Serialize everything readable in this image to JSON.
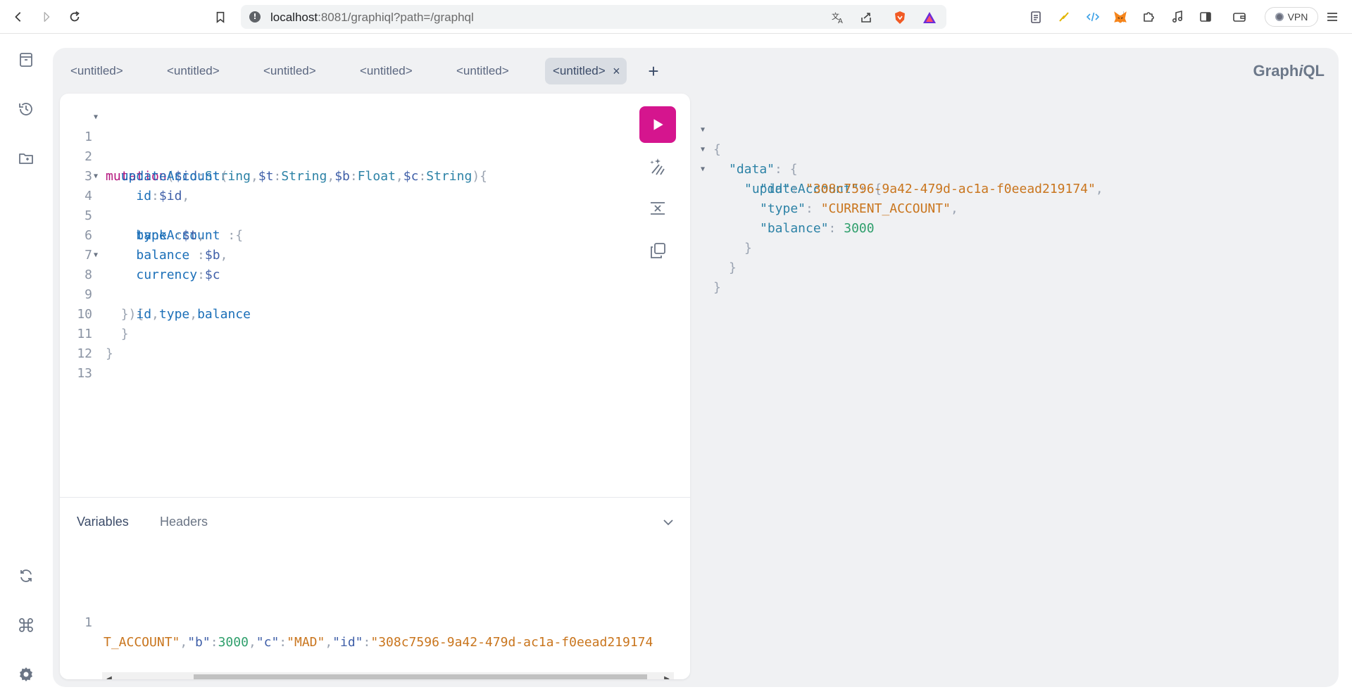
{
  "browser": {
    "url_host": "localhost",
    "url_rest": ":8081/graphiql?path=/graphql",
    "vpn_label": "VPN"
  },
  "sidebar": {
    "icons": [
      "documentation-icon",
      "history-icon",
      "explorer-icon",
      "refetch-schema-icon",
      "shortcuts-icon",
      "settings-icon"
    ]
  },
  "tabs": [
    {
      "label": "<untitled>"
    },
    {
      "label": "<untitled>"
    },
    {
      "label": "<untitled>"
    },
    {
      "label": "<untitled>"
    },
    {
      "label": "<untitled>"
    },
    {
      "label": "<untitled>",
      "active": true
    }
  ],
  "tab_close_label": "×",
  "tab_add_label": "+",
  "logo": {
    "prefix": "Graph",
    "italic": "i",
    "suffix": "QL"
  },
  "editor": {
    "line_numbers": [
      "1",
      "2",
      "3",
      "4",
      "5",
      "6",
      "7",
      "8",
      "9",
      "10",
      "11",
      "12",
      "13"
    ],
    "lines": {
      "l1": {
        "kw": "mutation",
        "p1": "(",
        "v1": "$id",
        "c1": ":",
        "t1": "String",
        "s1": ",",
        "v2": "$t",
        "c2": ":",
        "t2": "String",
        "s2": ",",
        "v3": "$b",
        "c3": ":",
        "t3": "Float",
        "s3": ",",
        "v4": "$c",
        "c4": ":",
        "t4": "String",
        "p2": "){"
      },
      "l2": {
        "indent": "  ",
        "field": "updateAccount",
        "p": "("
      },
      "l3": {
        "indent": "    ",
        "arg": "id",
        "c": ":",
        "v": "$id",
        "s": ","
      },
      "l4": {
        "indent": "    ",
        "arg": "bankAccount",
        "p": " :{"
      },
      "l5": {
        "indent": "    ",
        "arg": "type",
        "c": " :",
        "v": "$t",
        "s": ","
      },
      "l6": {
        "indent": "    ",
        "arg": "balance",
        "c": " :",
        "v": "$b",
        "s": ","
      },
      "l7": {
        "indent": "    ",
        "arg": "currency",
        "c": ":",
        "v": "$c"
      },
      "l8": {
        "indent": "  ",
        "p": "}){"
      },
      "l9": {
        "indent": "    ",
        "f1": "id",
        "s1": ",",
        "f2": "type",
        "s2": ",",
        "f3": "balance"
      },
      "l10": {
        "indent": "  ",
        "p": "}"
      },
      "l11": {
        "p": "}"
      }
    }
  },
  "variables_pane": {
    "tab_variables": "Variables",
    "tab_headers": "Headers",
    "line_number": "1",
    "content": {
      "a": "T_ACCOUNT\"",
      "s1": ",",
      "k1": "\"b\"",
      "c1": ":",
      "n1": "3000",
      "s2": ",",
      "k2": "\"c\"",
      "c2": ":",
      "v2": "\"MAD\"",
      "s3": ",",
      "k3": "\"id\"",
      "c3": ":",
      "v3": "\"308c7596-9a42-479d-ac1a-f0eead219174"
    }
  },
  "result": {
    "open": "{",
    "data_key": "\"data\"",
    "update_key": "\"updateAccount\"",
    "id_key": "\"id\"",
    "id_val": "\"308c7596-9a42-479d-ac1a-f0eead219174\"",
    "type_key": "\"type\"",
    "type_val": "\"CURRENT_ACCOUNT\"",
    "balance_key": "\"balance\"",
    "balance_val": "3000",
    "colon": ": ",
    "brace_open": "{",
    "brace_close": "}",
    "comma": ","
  }
}
